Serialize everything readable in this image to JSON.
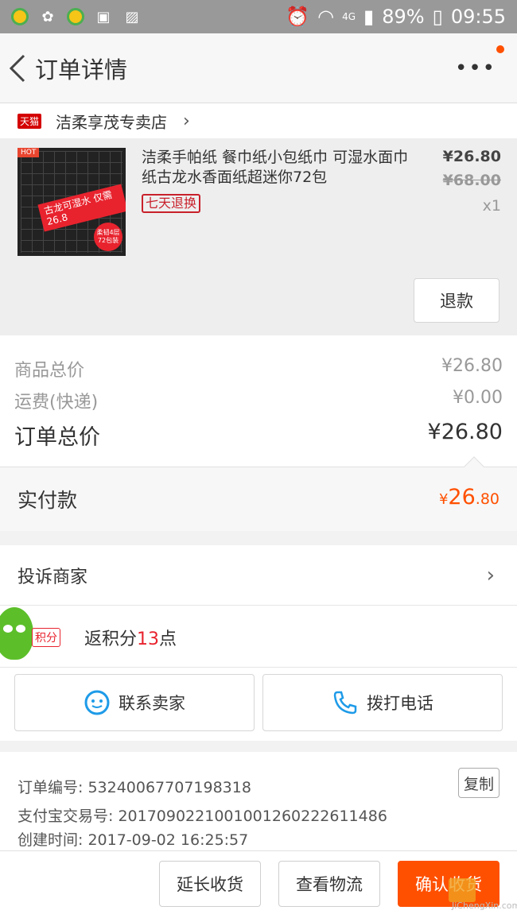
{
  "status_bar": {
    "battery": "89%",
    "time": "09:55",
    "network": "4G",
    "icons": [
      "app-icon",
      "flower-icon",
      "app-icon",
      "scan-icon",
      "image-icon",
      "alarm-icon",
      "wifi-icon",
      "signal-icon",
      "battery-icon"
    ]
  },
  "header": {
    "title": "订单详情",
    "more_label": "•••"
  },
  "shop": {
    "badge": "天猫",
    "name": "洁柔享茂专卖店"
  },
  "product": {
    "name": "洁柔手帕纸 餐巾纸小包纸巾 可湿水面巾纸古龙水香面纸超迷你72包",
    "tag": "七天退换",
    "price": "¥26.80",
    "original_price": "¥68.00",
    "quantity": "x1",
    "refund_label": "退款",
    "thumb_hot": "HOT",
    "thumb_promo": "古龙可湿水 仅需26.8",
    "thumb_badge": "柔韧4层 72包装"
  },
  "summary": {
    "goods_total_label": "商品总价",
    "goods_total_value": "¥26.80",
    "shipping_label": "运费(快递)",
    "shipping_value": "¥0.00",
    "order_total_label": "订单总价",
    "order_total_value": "¥26.80"
  },
  "paid": {
    "label": "实付款",
    "currency": "¥",
    "integer": "26",
    "decimal": ".80"
  },
  "complaint": {
    "label": "投诉商家"
  },
  "points": {
    "badge": "积分",
    "prefix": "返积分",
    "number": "13",
    "suffix": "点"
  },
  "actions": {
    "contact_seller": "联系卖家",
    "call_phone": "拨打电话"
  },
  "order_info": {
    "order_no": "订单编号: 53240067707198318",
    "alipay_no": "支付宝交易号: 2017090221001001260222611486",
    "created_at": "创建时间: 2017-09-02 16:25:57",
    "copy_label": "复制"
  },
  "bottom_bar": {
    "extend_label": "延长收货",
    "logistics_label": "查看物流",
    "confirm_label": "确认收货"
  },
  "colors": {
    "accent": "#ff5000",
    "tmall_red": "#d40000",
    "tag_red": "#c8202b"
  }
}
